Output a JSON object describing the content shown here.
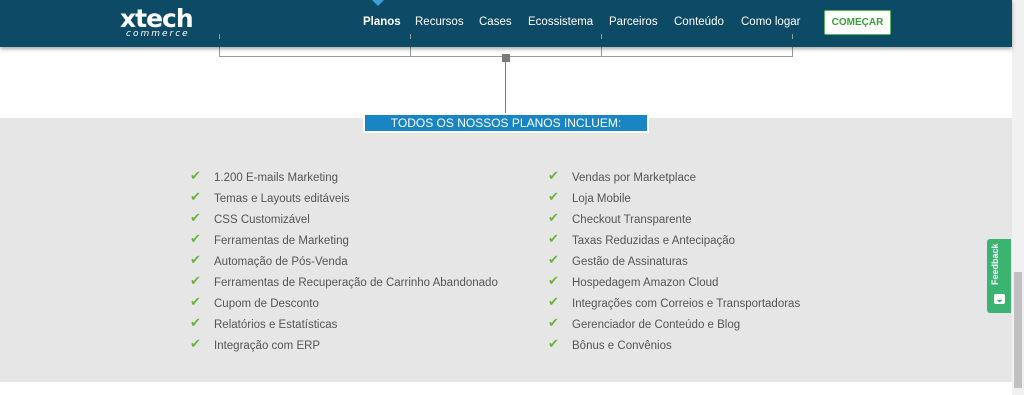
{
  "header": {
    "logo_main": "xtech",
    "logo_sub": "commerce",
    "nav": [
      "Planos",
      "Recursos",
      "Cases",
      "Ecossistema",
      "Parceiros",
      "Conteúdo",
      "Como logar"
    ],
    "active_nav": "Planos",
    "cta_label": "COMEÇAR"
  },
  "section": {
    "title": "TODOS OS NOSSOS PLANOS INCLUEM:",
    "left_features": [
      "1.200 E-mails Marketing",
      "Temas e Layouts editáveis",
      "CSS Customizável",
      "Ferramentas de Marketing",
      "Automação de Pós-Venda",
      "Ferramentas de Recuperação de Carrinho Abandonado",
      "Cupom de Desconto",
      "Relatórios e Estatísticas",
      "Integração com ERP"
    ],
    "right_features": [
      "Vendas por Marketplace",
      "Loja Mobile",
      "Checkout Transparente",
      "Taxas Reduzidas e Antecipação",
      "Gestão de Assinaturas",
      "Hospedagem Amazon Cloud",
      "Integrações com Correios e Transportadoras",
      "Gerenciador de Conteúdo e Blog",
      "Bônus e Convênios"
    ]
  },
  "feedback": {
    "label": "Feedback"
  },
  "colors": {
    "header_bg": "#0d4a66",
    "accent_blue": "#1a85c5",
    "check_green": "#6bb33c",
    "feedback_green": "#3cb371"
  },
  "icons": {
    "check": "check-icon",
    "feedback": "feedback-icon"
  }
}
